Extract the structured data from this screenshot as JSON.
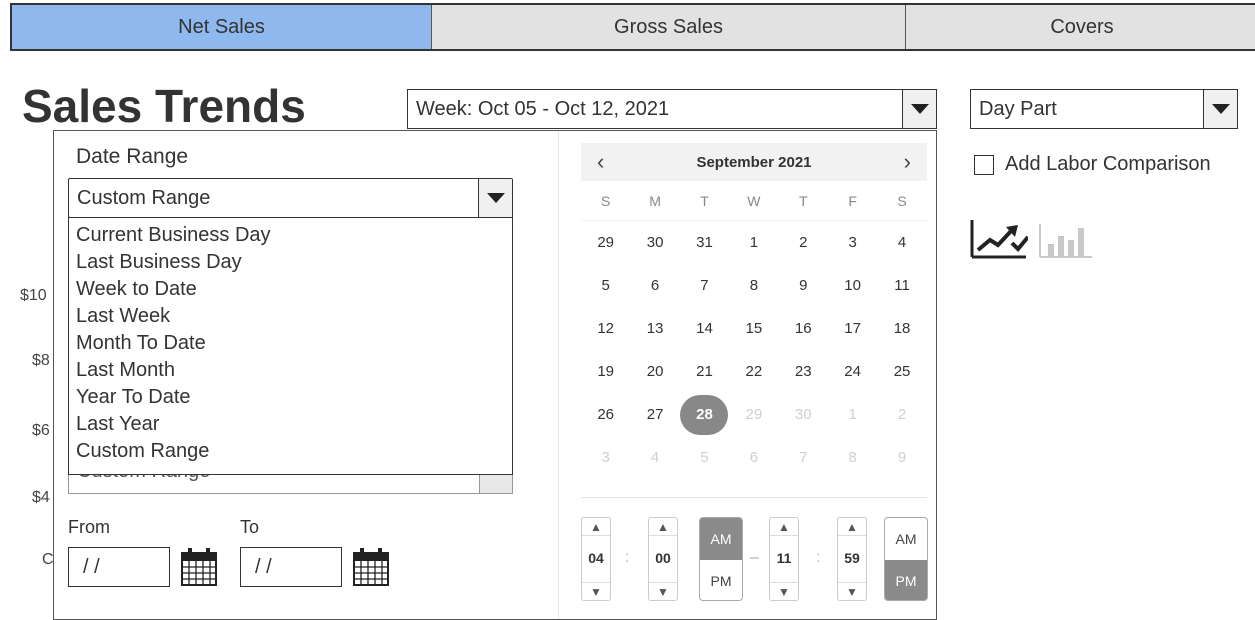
{
  "tabs": [
    {
      "label": "Net Sales",
      "active": true
    },
    {
      "label": "Gross Sales",
      "active": false
    },
    {
      "label": "Covers",
      "active": false
    }
  ],
  "title": "Sales Trends",
  "week_select": {
    "value": "Week: Oct 05 - Oct 12, 2021"
  },
  "daypart_select": {
    "value": "Day Part"
  },
  "labor_comparison": {
    "label": "Add Labor Comparison",
    "checked": false
  },
  "chart_icons": {
    "line_icon": "line-chart-icon",
    "check_icon": "check-icon",
    "bar_icon": "bar-chart-icon"
  },
  "y_axis_stubs": [
    "$10",
    "$8",
    "$6",
    "$4",
    "C"
  ],
  "date_range": {
    "label": "Date Range",
    "selected": "Custom Range",
    "options": [
      "Current Business Day",
      "Last Business Day",
      "Week to Date",
      "Last Week",
      "Month To Date",
      "Last Month",
      "Year To Date",
      "Last Year",
      "Custom Range"
    ],
    "from_label": "From",
    "to_label": "To",
    "from_value": "/ /",
    "to_value": "/ /"
  },
  "calendar": {
    "prev": "‹",
    "next": "›",
    "month_label": "September 2021",
    "weekdays": [
      "S",
      "M",
      "T",
      "W",
      "T",
      "F",
      "S"
    ],
    "weeks": [
      [
        "29",
        "30",
        "31",
        "1",
        "2",
        "3",
        "4"
      ],
      [
        "5",
        "6",
        "7",
        "8",
        "9",
        "10",
        "11"
      ],
      [
        "12",
        "13",
        "14",
        "15",
        "16",
        "17",
        "18"
      ],
      [
        "19",
        "20",
        "21",
        "22",
        "23",
        "24",
        "25"
      ],
      [
        "26",
        "27",
        "28",
        "29",
        "30",
        "1",
        "2"
      ],
      [
        "3",
        "4",
        "5",
        "6",
        "7",
        "8",
        "9"
      ]
    ],
    "selected_day": "28"
  },
  "time": {
    "start": {
      "hour": "04",
      "minute": "00",
      "am": "AM",
      "pm": "PM",
      "period": "AM"
    },
    "end": {
      "hour": "11",
      "minute": "59",
      "am": "AM",
      "pm": "PM",
      "period": "PM"
    },
    "separator": "–",
    "colon": ":"
  },
  "colors": {
    "active_tab": "#8fb8ee",
    "inactive_tab": "#e2e2e2",
    "selected_day": "#888888"
  }
}
